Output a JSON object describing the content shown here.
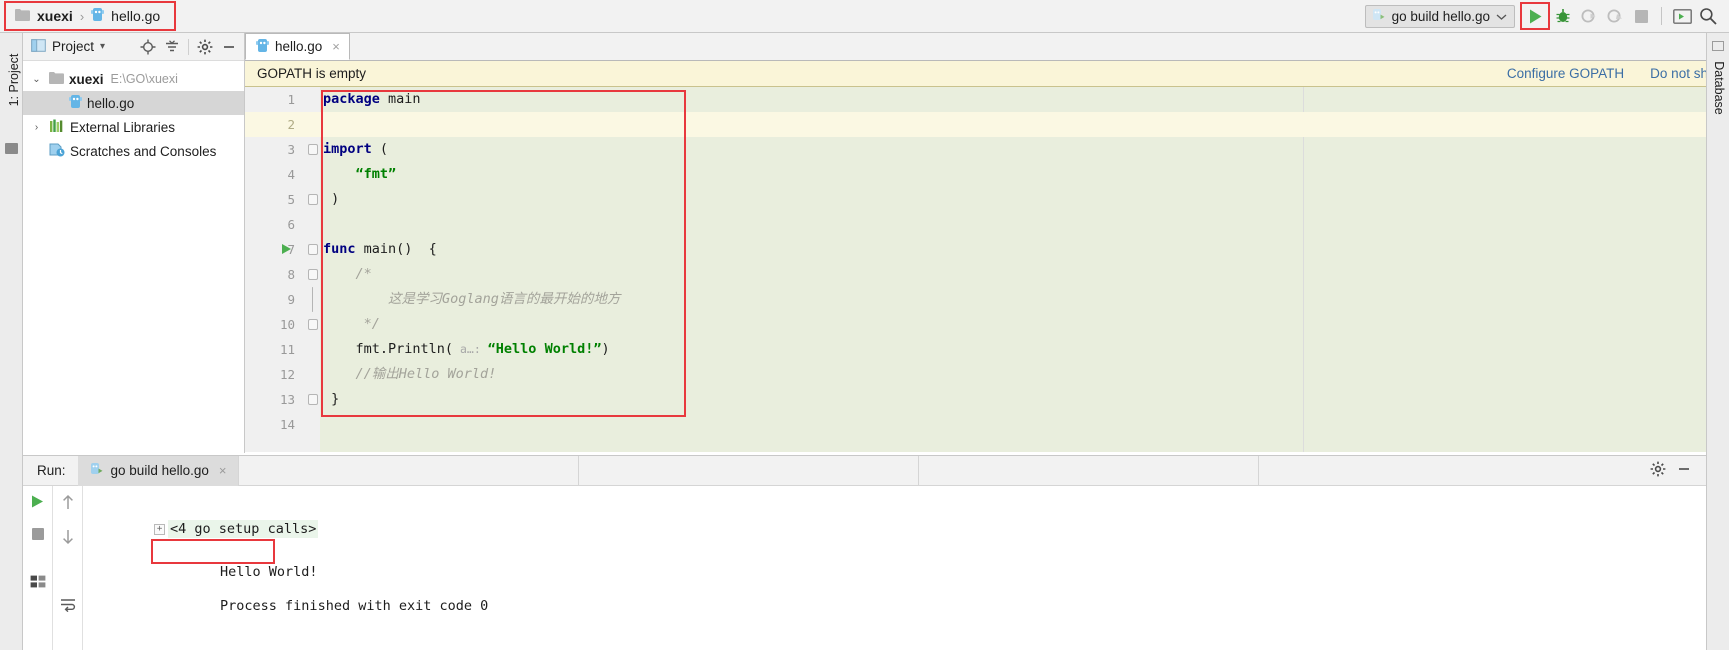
{
  "breadcrumb": {
    "project": "xuexi",
    "separator": "›",
    "file": "hello.go",
    "folder_icon": "folder-icon",
    "file_icon": "go-file-icon"
  },
  "toolbar": {
    "run_config": "go build hello.go",
    "dropdown_caret": "⌄",
    "icons": [
      {
        "name": "run-icon",
        "label": "Run",
        "state": "enabled",
        "color": "#4caf50"
      },
      {
        "name": "debug-icon",
        "label": "Debug",
        "state": "enabled",
        "color": "#389438"
      },
      {
        "name": "run-with-coverage-icon",
        "label": "Run with Coverage",
        "state": "disabled",
        "color": "#bdbdbd"
      },
      {
        "name": "profile-icon",
        "label": "Profile",
        "state": "disabled",
        "color": "#bdbdbd"
      },
      {
        "name": "stop-icon",
        "label": "Stop",
        "state": "disabled",
        "color": "#b6b6b6"
      },
      {
        "name": "console-icon",
        "label": "Console",
        "state": "enabled",
        "color": "#6f6f6f"
      },
      {
        "name": "search-icon",
        "label": "Search Everywhere",
        "state": "enabled",
        "color": "#4a4a4a"
      }
    ]
  },
  "left_strip": {
    "tool_tab": "1: Project",
    "structure_icon": "structure-icon"
  },
  "right_strip": {
    "tool_tab": "Database"
  },
  "project_panel": {
    "title": "Project",
    "title_caret": "▾",
    "header_icons": [
      {
        "name": "locate-target-icon"
      },
      {
        "name": "collapse-all-icon"
      },
      {
        "name": "gear-icon"
      },
      {
        "name": "hide-panel-icon"
      }
    ],
    "tree": [
      {
        "arrow": "⌄",
        "icon": "folder-icon",
        "label": "xuexi",
        "path": "E:\\GO\\xuexi",
        "bold": true,
        "indent": 0,
        "selected": false
      },
      {
        "arrow": "",
        "icon": "go-file-icon",
        "label": "hello.go",
        "path": "",
        "bold": false,
        "indent": 1,
        "selected": true
      },
      {
        "arrow": "›",
        "icon": "libraries-icon",
        "label": "External Libraries",
        "path": "",
        "bold": false,
        "indent": 0,
        "selected": false
      },
      {
        "arrow": "",
        "icon": "scratches-icon",
        "label": "Scratches and Consoles",
        "path": "",
        "bold": false,
        "indent": 0,
        "selected": false
      }
    ]
  },
  "editor": {
    "tab": {
      "label": "hello.go",
      "icon": "go-file-icon",
      "close": "×"
    },
    "banner": {
      "message": "GOPATH is empty",
      "link_configure": "Configure GOPATH",
      "link_dismiss": "Do not show again"
    },
    "inspection_status": "✓",
    "code": [
      {
        "num": "1",
        "cursor": false,
        "run": false,
        "fold": "",
        "segments": [
          {
            "t": "package",
            "c": "kw"
          },
          {
            "t": " main",
            "c": "plain"
          }
        ]
      },
      {
        "num": "2",
        "cursor": true,
        "run": false,
        "fold": "",
        "segments": []
      },
      {
        "num": "3",
        "cursor": false,
        "run": false,
        "fold": "open",
        "segments": [
          {
            "t": "import",
            "c": "kw"
          },
          {
            "t": " (",
            "c": "plain"
          }
        ]
      },
      {
        "num": "4",
        "cursor": false,
        "run": false,
        "fold": "",
        "segments": [
          {
            "t": "    “fmt”",
            "c": "str"
          }
        ]
      },
      {
        "num": "5",
        "cursor": false,
        "run": false,
        "fold": "close",
        "segments": [
          {
            "t": " )",
            "c": "plain"
          }
        ]
      },
      {
        "num": "6",
        "cursor": false,
        "run": false,
        "fold": "",
        "segments": []
      },
      {
        "num": "7",
        "cursor": false,
        "run": true,
        "fold": "open",
        "segments": [
          {
            "t": "func",
            "c": "kw"
          },
          {
            "t": " main()  {",
            "c": "plain"
          }
        ]
      },
      {
        "num": "8",
        "cursor": false,
        "run": false,
        "fold": "open",
        "segments": [
          {
            "t": "    /*",
            "c": "cmt"
          }
        ]
      },
      {
        "num": "9",
        "cursor": false,
        "run": false,
        "fold": "bar",
        "segments": [
          {
            "t": "        这是学习Goglang语言的最开始的地方",
            "c": "cmt"
          }
        ]
      },
      {
        "num": "10",
        "cursor": false,
        "run": false,
        "fold": "close",
        "segments": [
          {
            "t": "     */",
            "c": "cmt"
          }
        ]
      },
      {
        "num": "11",
        "cursor": false,
        "run": false,
        "fold": "",
        "segments": [
          {
            "t": "    fmt.Println(",
            "c": "plain"
          },
          {
            "t": " a…: ",
            "c": "hint"
          },
          {
            "t": "“Hello World!”",
            "c": "str"
          },
          {
            "t": ")",
            "c": "plain"
          }
        ]
      },
      {
        "num": "12",
        "cursor": false,
        "run": false,
        "fold": "",
        "segments": [
          {
            "t": "    //输出Hello World!",
            "c": "cmt"
          }
        ]
      },
      {
        "num": "13",
        "cursor": false,
        "run": false,
        "fold": "close",
        "segments": [
          {
            "t": " }",
            "c": "plain"
          }
        ]
      },
      {
        "num": "14",
        "cursor": false,
        "run": false,
        "fold": "",
        "segments": []
      }
    ]
  },
  "run_panel": {
    "label": "Run:",
    "tab": {
      "label": "go build hello.go",
      "icon": "go-run-icon",
      "close": "×"
    },
    "header_icons": [
      {
        "name": "gear-icon"
      },
      {
        "name": "hide-panel-icon"
      }
    ],
    "side_icons": [
      {
        "name": "rerun-icon",
        "color": "#4caf50"
      },
      {
        "name": "stop-icon",
        "color": "#9b9b9b"
      },
      {
        "name": "toggle-tasks-icon",
        "color": "#5a5a5a"
      },
      {
        "name": "scroll-up-icon",
        "color": "#9b9b9b"
      },
      {
        "name": "scroll-down-icon",
        "color": "#9b9b9b"
      },
      {
        "name": "soft-wrap-icon",
        "color": "#5a5a5a"
      }
    ],
    "console": {
      "setup_calls": "<4 go setup calls>",
      "setup_fold": "+",
      "output": "Hello World!",
      "exit_message": "Process finished with exit code 0"
    }
  },
  "highlights": {
    "accent_red": "#e8383d",
    "run_green": "#4caf50",
    "code_bg": "#e9eedd",
    "banner_bg": "#faf5d8",
    "link_blue": "#3b6ea5"
  }
}
